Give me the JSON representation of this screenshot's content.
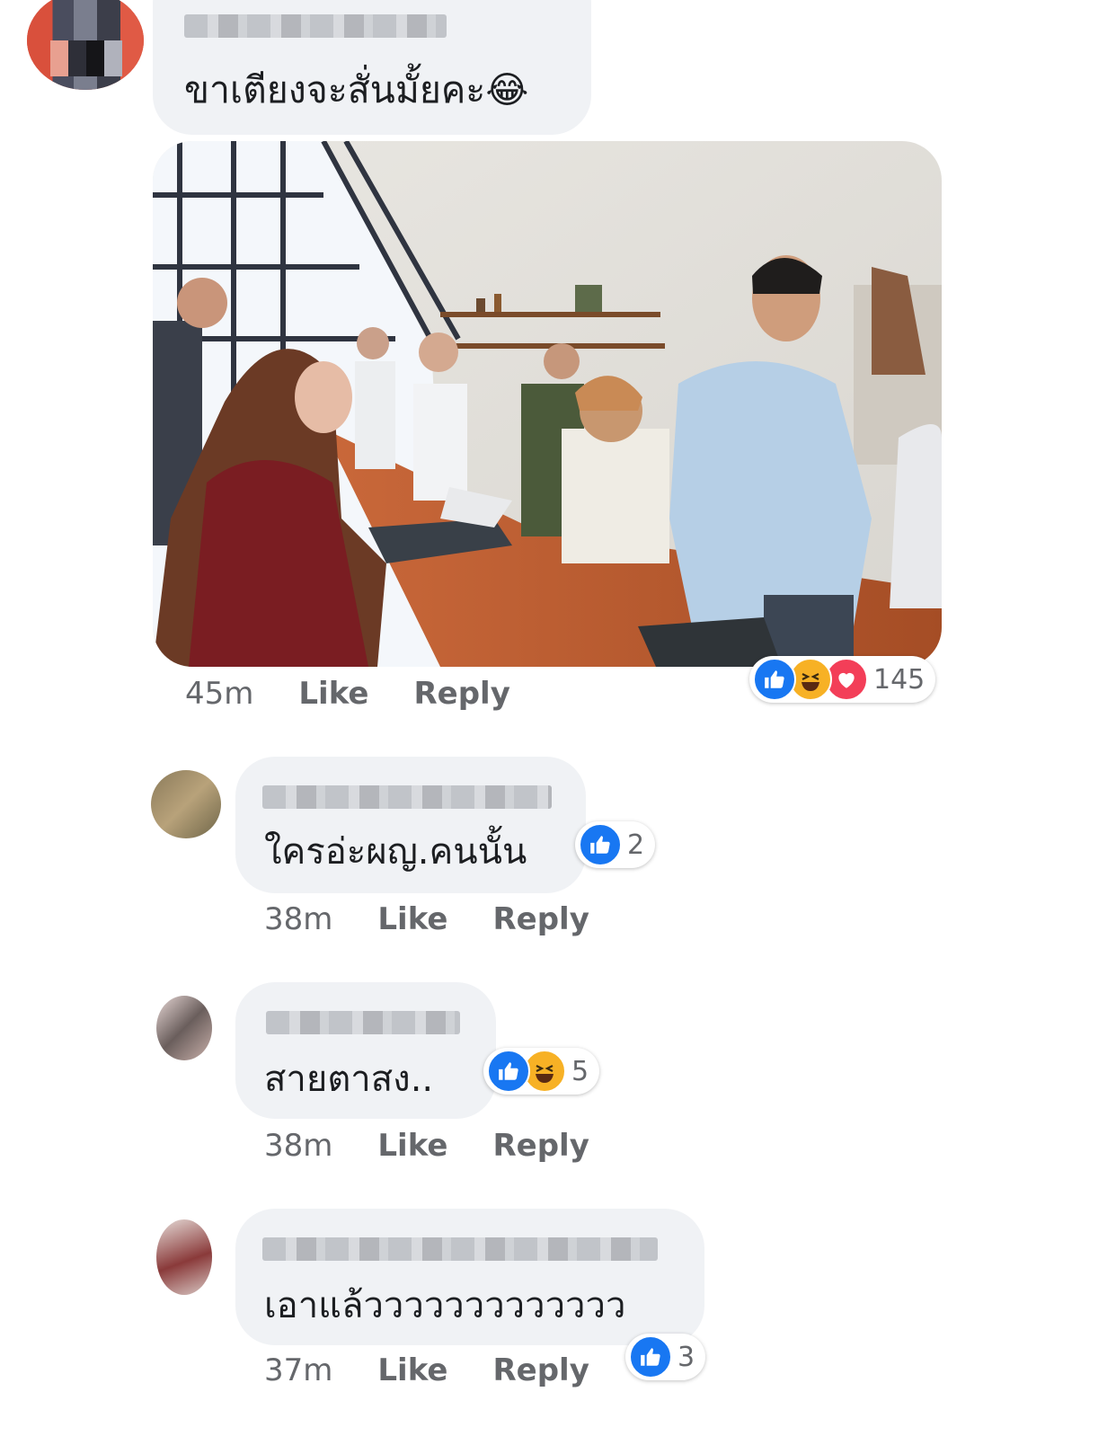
{
  "comments": [
    {
      "author": "",
      "text": "ขาเตียงจะสั่นมั้ยคะ😂",
      "time": "45m",
      "like_label": "Like",
      "reply_label": "Reply",
      "reactions": {
        "types": [
          "like",
          "haha",
          "love"
        ],
        "count": "145"
      },
      "has_photo": true
    },
    {
      "author": "",
      "text": "ใครอ่ะผญ.คนนั้น",
      "time": "38m",
      "like_label": "Like",
      "reply_label": "Reply",
      "reactions": {
        "types": [
          "like"
        ],
        "count": "2"
      }
    },
    {
      "author": "",
      "text": "สายตาสง..",
      "time": "38m",
      "like_label": "Like",
      "reply_label": "Reply",
      "reactions": {
        "types": [
          "like",
          "haha"
        ],
        "count": "5"
      }
    },
    {
      "author": "",
      "text": "เอาแล้ววววววววววววว",
      "time": "37m",
      "like_label": "Like",
      "reply_label": "Reply",
      "reactions": {
        "types": [
          "like"
        ],
        "count": "3"
      }
    }
  ],
  "colors": {
    "like": "#1877f2",
    "haha": "#f7b125",
    "love": "#f33e58",
    "bubble": "#f0f2f5",
    "meta": "#65676b"
  }
}
